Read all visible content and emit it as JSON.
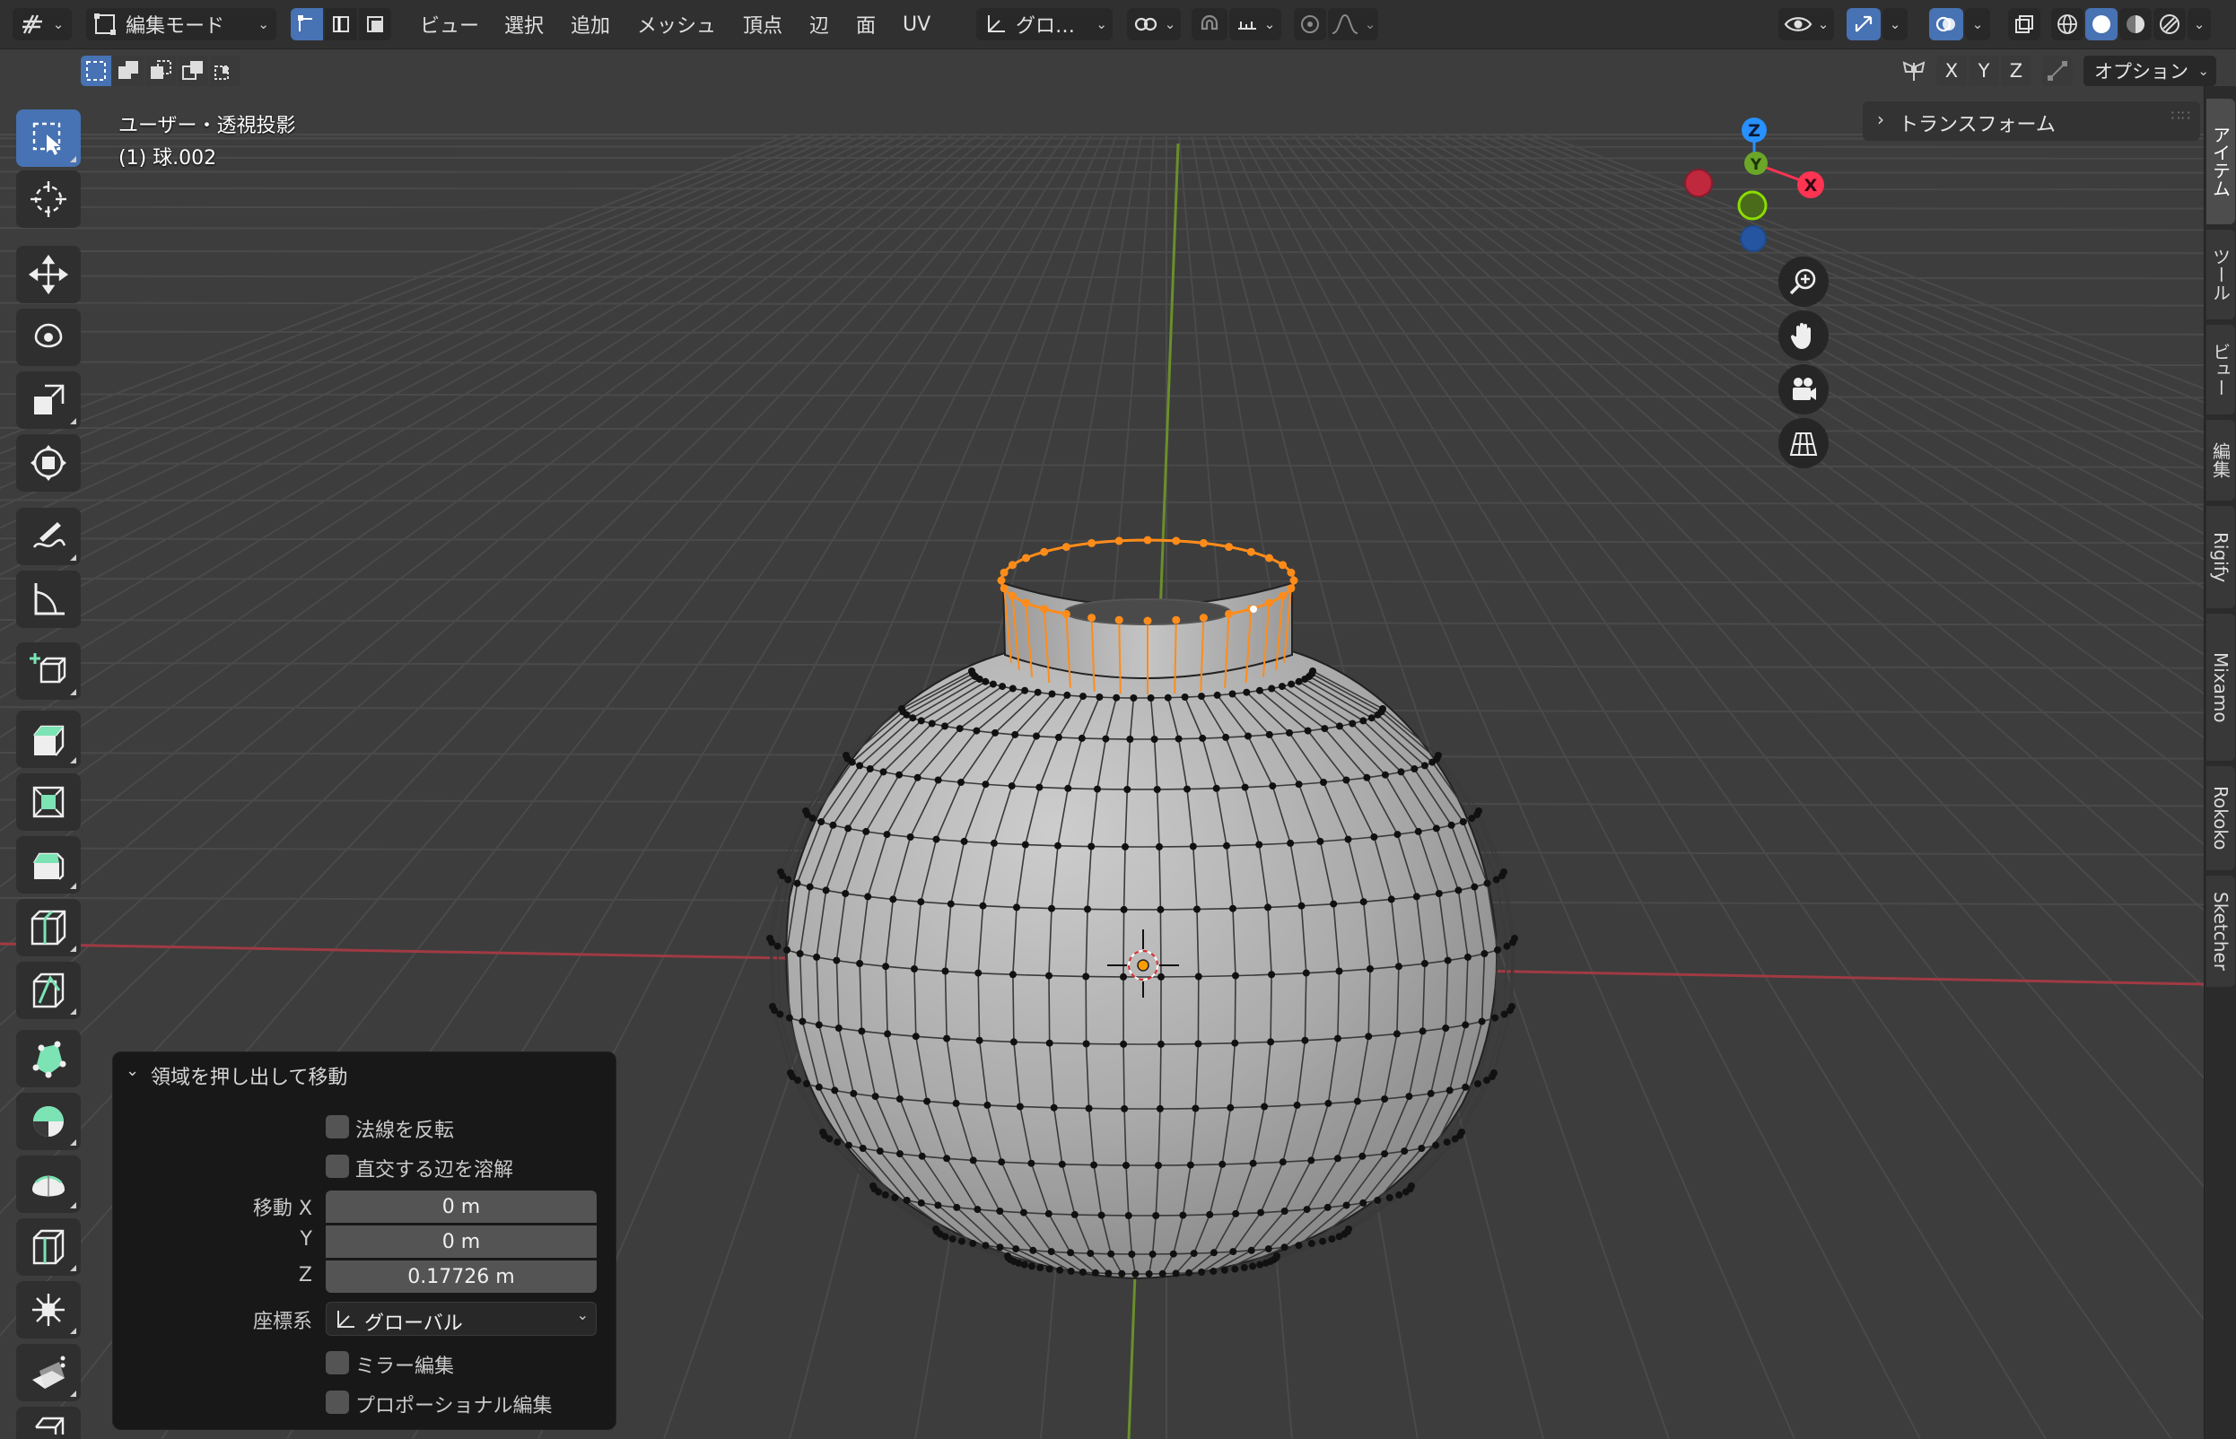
{
  "header": {
    "mode_label": "編集モード",
    "menus": [
      "ビュー",
      "選択",
      "追加",
      "メッシュ",
      "頂点",
      "辺",
      "面",
      "UV"
    ],
    "transform_orientation": "グロ…",
    "axes": [
      "X",
      "Y",
      "Z"
    ],
    "options_label": "オプション"
  },
  "viewport": {
    "view_name": "ユーザー・透視投影",
    "object_name": "(1) 球.002",
    "gizmo_axes": [
      "Z",
      "Y",
      "X"
    ]
  },
  "sidebar": {
    "panel_title": "トランスフォーム",
    "tabs": [
      "アイテム",
      "ツール",
      "ビュー",
      "編集",
      "Rigify",
      "Mixamo",
      "Rokoko",
      "Sketcher"
    ]
  },
  "operator_panel": {
    "title": "領域を押し出して移動",
    "flip_normals_label": "法線を反転",
    "dissolve_edges_label": "直交する辺を溶解",
    "move_label": "移動 X",
    "y_label": "Y",
    "z_label": "Z",
    "move_x": "0 m",
    "move_y": "0 m",
    "move_z": "0.17726 m",
    "orientation_label": "座標系",
    "orientation_value": "グローバル",
    "mirror_label": "ミラー編集",
    "proportional_label": "プロポーショナル編集"
  },
  "colors": {
    "accent": "#4772b3",
    "selected_edge": "#ff8c1a",
    "x_axis": "#ff3352",
    "y_axis": "#8bdc00",
    "z_axis": "#2890ff"
  }
}
